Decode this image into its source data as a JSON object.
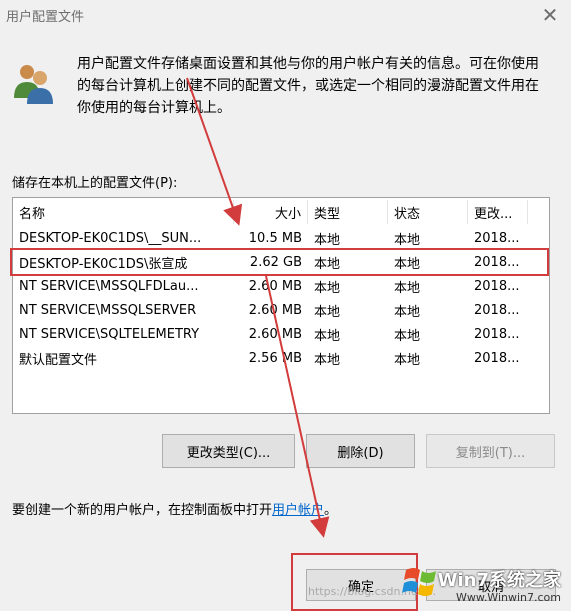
{
  "window": {
    "title": "用户配置文件",
    "close_glyph": "✕"
  },
  "intro": {
    "text": "用户配置文件存储桌面设置和其他与你的用户帐户有关的信息。可在你使用的每台计算机上创建不同的配置文件，或选定一个相同的漫游配置文件用在你使用的每台计算机上。"
  },
  "profiles": {
    "label": "储存在本机上的配置文件(P):",
    "columns": [
      "名称",
      "大小",
      "类型",
      "状态",
      "更改..."
    ],
    "rows": [
      {
        "name": "DESKTOP-EK0C1DS\\__SUN...",
        "size": "10.5 MB",
        "type": "本地",
        "status": "本地",
        "changed": "2018..."
      },
      {
        "name": "DESKTOP-EK0C1DS\\张宣成",
        "size": "2.62 GB",
        "type": "本地",
        "status": "本地",
        "changed": "2018..."
      },
      {
        "name": "NT SERVICE\\MSSQLFDLau...",
        "size": "2.60 MB",
        "type": "本地",
        "status": "本地",
        "changed": "2018..."
      },
      {
        "name": "NT SERVICE\\MSSQLSERVER",
        "size": "2.60 MB",
        "type": "本地",
        "status": "本地",
        "changed": "2018..."
      },
      {
        "name": "NT SERVICE\\SQLTELEMETRY",
        "size": "2.60 MB",
        "type": "本地",
        "status": "本地",
        "changed": "2018..."
      },
      {
        "name": "默认配置文件",
        "size": "2.56 MB",
        "type": "本地",
        "status": "本地",
        "changed": "2018..."
      }
    ]
  },
  "buttons": {
    "change_type": "更改类型(C)...",
    "delete": "删除(D)",
    "copy_to": "复制到(T)...",
    "ok": "确定",
    "cancel": "取消"
  },
  "create": {
    "text": "要创建一个新的用户帐户，在控制面板中打开",
    "link": "用户帐户",
    "suffix": "。"
  },
  "watermark": {
    "brand": "Win7系统之家",
    "url": "Www.Winwin7.com",
    "csdn": "https://blog.csdn.net/..."
  },
  "colors": {
    "highlight_box": "#d23c3c",
    "arrow": "#d23c3c",
    "link": "#0066cc"
  }
}
